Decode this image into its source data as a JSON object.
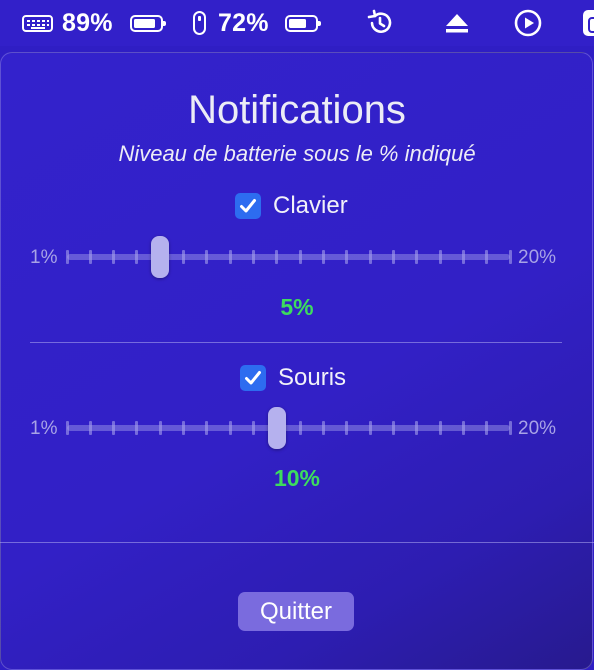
{
  "menubar": {
    "keyboard_percent": "89%",
    "keyboard_battery_level": 0.89,
    "mouse_percent": "72%",
    "mouse_battery_level": 0.72,
    "icons": [
      "keyboard-icon",
      "battery-icon",
      "mouse-icon",
      "battery-icon",
      "time-machine-icon",
      "eject-icon",
      "play-icon",
      "app-icon"
    ]
  },
  "popover": {
    "title": "Notifications",
    "subtitle": "Niveau de batterie sous le % indiqué",
    "keyboard": {
      "label": "Clavier",
      "checked": true,
      "min_label": "1%",
      "max_label": "20%",
      "min": 1,
      "max": 20,
      "value": 5,
      "value_label": "5%"
    },
    "mouse": {
      "label": "Souris",
      "checked": true,
      "min_label": "1%",
      "max_label": "20%",
      "min": 1,
      "max": 20,
      "value": 10,
      "value_label": "10%"
    },
    "quit_label": "Quitter"
  },
  "colors": {
    "background": "#3220c9",
    "accent_green": "#3ddc5e",
    "checkbox_blue": "#2d6cf0",
    "button": "#7a6bde"
  }
}
